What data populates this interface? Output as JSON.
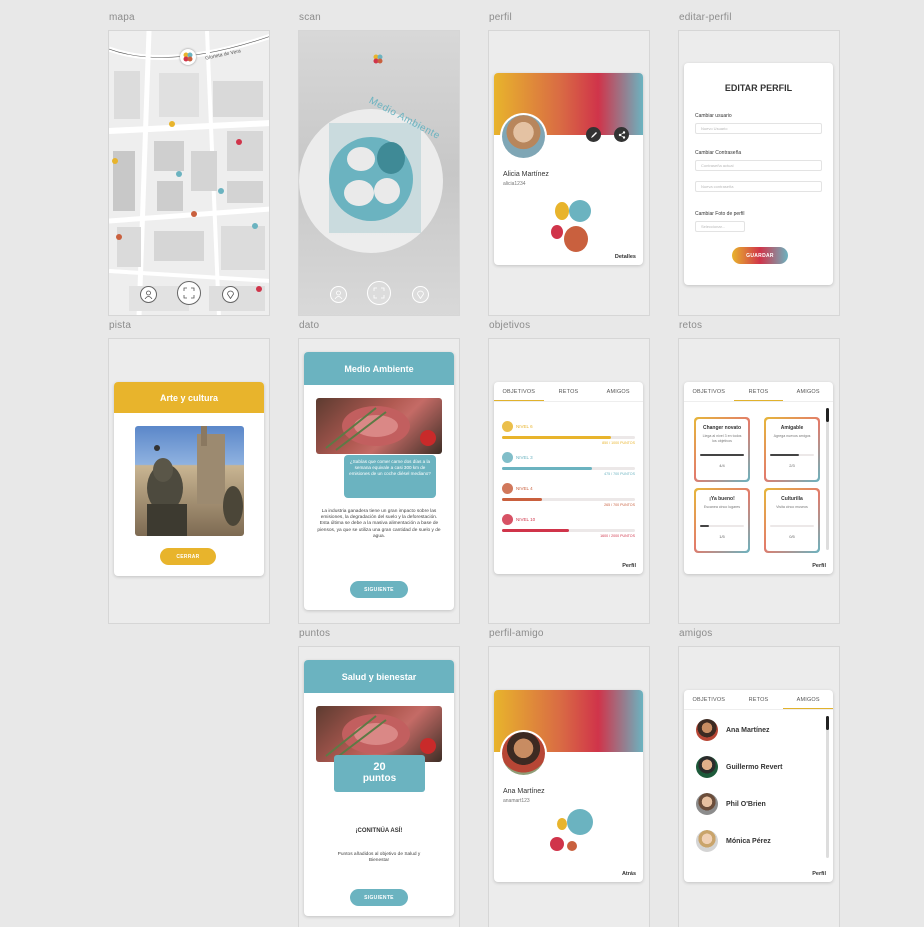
{
  "frames": {
    "mapa": "mapa",
    "scan": "scan",
    "perfil": "perfil",
    "editar": "editar-perfil",
    "pista": "pista",
    "dato": "dato",
    "objetivos": "objetivos",
    "retos": "retos",
    "puntos": "puntos",
    "perfil_amigo": "perfil-amigo",
    "amigos": "amigos"
  },
  "map": {
    "street_label": "Glorieta de Vera"
  },
  "scan": {
    "curved_text": "Medio Ambiente"
  },
  "profile": {
    "name": "Alicia Martínez",
    "username": "alicia1234",
    "details_link": "Detalles"
  },
  "edit_profile": {
    "title": "EDITAR PERFIL",
    "change_user_label": "Cambiar usuario",
    "new_user_placeholder": "Nuevo Usuario",
    "change_password_label": "Cambiar Contraseña",
    "current_password_placeholder": "Contraseña actual",
    "new_password_placeholder": "Nueva contraseña",
    "change_photo_label": "Cambiar Foto de perfil",
    "select_placeholder": "Seleccionar...",
    "save_button": "GUARDAR"
  },
  "clue": {
    "title": "Arte y cultura",
    "close_button": "CERRAR"
  },
  "fact": {
    "title": "Medio Ambiente",
    "bubble": "¿Sabías que comer carne dos días a la semana equivale a casi 300 km de emisiones de un coche diésel mediano?",
    "body": "La industria ganadera tiene un gran impacto sobre las emisiones, la degradación del suelo y la deforestación. Esta última se debe a la masiva alimentación a base de piensos, ya que se utiliza una gran cantidad de suelo y de agua.",
    "next_button": "SIGUIENTE"
  },
  "tabs": {
    "objectives": "OBJETIVOS",
    "challenges": "RETOS",
    "friends": "AMIGOS"
  },
  "objectives": {
    "items": [
      {
        "level": "NIVEL 6",
        "score": "850 / 1000 PUNTOS",
        "progress": 0.82,
        "color": "#e8b42c"
      },
      {
        "level": "NIVEL 3",
        "score": "475 / 700 PUNTOS",
        "progress": 0.68,
        "color": "#6bb3c0"
      },
      {
        "level": "NIVEL 4",
        "score": "265 / 700 PUNTOS",
        "progress": 0.3,
        "color": "#c9603e"
      },
      {
        "level": "NIVEL 10",
        "score": "1600 / 2000 PUNTOS",
        "progress": 0.5,
        "color": "#d0344a"
      }
    ],
    "footer_link": "Perfil"
  },
  "challenges": {
    "items": [
      {
        "title": "Changer novato",
        "desc": "Llega al nivel 3 en todos los objetivos",
        "count": "4/4",
        "progress": 1.0
      },
      {
        "title": "Amigable",
        "desc": "Agrega nuevos amigos",
        "count": "2/3",
        "progress": 0.66
      },
      {
        "title": "¡Ya bueno!",
        "desc": "Escanea cinco lugares",
        "count": "1/5",
        "progress": 0.2
      },
      {
        "title": "Culturilla",
        "desc": "Visita cinco museos",
        "count": "0/5",
        "progress": 0.0
      }
    ],
    "footer_link": "Perfil"
  },
  "points": {
    "title": "Salud y bienestar",
    "points_value": "20",
    "points_label": "puntos",
    "cheer": "¡CONITNÚA ASÍ!",
    "message": "Puntos añadidos al objetivo de Salud y Bienestar",
    "next_button": "SIGUIENTE"
  },
  "friend_profile": {
    "name": "Ana Martínez",
    "username": "anamart123",
    "back_link": "Atrás"
  },
  "friends": {
    "items": [
      "Ana Martínez",
      "Guillermo Revert",
      "Phil O'Brien",
      "Mónica Pérez"
    ],
    "footer_link": "Perfil"
  },
  "colors": {
    "yellow": "#e8b42c",
    "teal": "#6bb3c0",
    "red": "#d0344a",
    "orange": "#c9603e"
  }
}
